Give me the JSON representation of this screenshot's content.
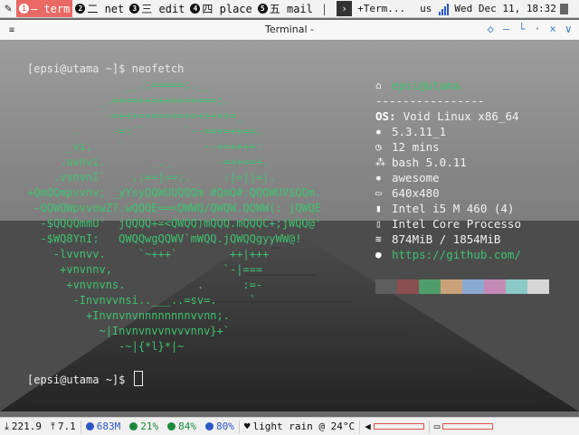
{
  "topbar": {
    "tags": [
      {
        "num": "1",
        "label": "— term",
        "active": true
      },
      {
        "num": "2",
        "label": "二 net",
        "active": false
      },
      {
        "num": "3",
        "label": "三 edit",
        "active": false
      },
      {
        "num": "4",
        "label": "四 place",
        "active": false
      },
      {
        "num": "5",
        "label": "五 mail",
        "active": false
      }
    ],
    "separator": "|",
    "task_title": "+Term...",
    "task_title2": "us",
    "clock": "Wed Dec 11, 18:32"
  },
  "window": {
    "title": "Terminal -",
    "menu_glyph": "≡",
    "buttons": [
      "◇",
      "—",
      "└",
      "·",
      "×",
      "∨"
    ]
  },
  "terminal": {
    "prompt1": "[epsi@utama ~]$ neofetch",
    "prompt2": "[epsi@utama ~]$ ",
    "logo_lines": [
      "               __.;=====;.__",
      "           _.=+==++=++=+=+===;.",
      "            -=+++=+===+=+=+++++=_",
      "       .     -=:``      `--==+=++==.",
      "      _vi,    `            --+=++++:",
      "     .uvnvi.       _._       -==+==+.",
      "    .vvnvnI`    .;==|==;.     :|=||=|.",
      "+QmQQmpvvnv; _yYsyQQWUUQQQm #QmQ#:QQQWUV$QQm.",
      " -QQWQWpvvowZ?.wQQQE==<QWWQ/QWQW.QQWW(: jQWQE",
      "  -$QQQQmmU'  jQQQQ+=<QWQQ)mQQQ.mQQQC+;jWQQ@'",
      "  -$WQ8YnI:   QWQQwgQQWV`mWQQ.jQWQQgyyWW@!",
      "    -lvvnvv.     `~+++`        ++|+++",
      "     +vnvnnv,                 `-|===",
      "      +vnvnvns.           .      :=-",
      "       -Invnvvnsi..___..=sv=.     `",
      "         +Invnvnvnnnnnnnnvvnn;.",
      "           ~|Invnvnvvnvvvnnv}+`",
      "              -~|{*l}*|~"
    ],
    "info": {
      "user": "epsi",
      "host": "utama",
      "rule": "----------------",
      "rows": [
        {
          "icon": "os-icon",
          "glyph": "OS:",
          "value": "Void Linux x86_64"
        },
        {
          "icon": "kernel-icon",
          "glyph": "✹",
          "value": "5.3.11_1"
        },
        {
          "icon": "uptime-clock-icon",
          "glyph": "◷",
          "value": "12 mins"
        },
        {
          "icon": "shell-icon",
          "glyph": "⁂",
          "value": "bash 5.0.11"
        },
        {
          "icon": "wm-icon",
          "glyph": "✹",
          "value": "awesome"
        },
        {
          "icon": "monitor-icon",
          "glyph": "▭",
          "value": "640x480"
        },
        {
          "icon": "cpu-icon",
          "glyph": "▮",
          "value": "Intel i5 M 460 (4)"
        },
        {
          "icon": "gpu-icon",
          "glyph": "▯",
          "value": "Intel Core Processo"
        },
        {
          "icon": "memory-icon",
          "glyph": "≋",
          "value": "874MiB / 1854MiB"
        },
        {
          "icon": "github-icon",
          "glyph": "●",
          "value": "https://github.com/"
        }
      ]
    },
    "palette": [
      "#5e5e5e",
      "#8a4f4f",
      "#4f9e6a",
      "#caa27a",
      "#8aa9d2",
      "#c48ab6",
      "#8ac9c6",
      "#d6d6d6"
    ]
  },
  "bottombar": {
    "net_down": "221.9",
    "net_up": "7.1",
    "mem": "683M",
    "cpu": "21%",
    "disk": "84%",
    "battery_or_vol": "80%",
    "weather": "light rain @ 24°C",
    "volume_fraction": 0.0,
    "brightness_fraction": 0.0
  }
}
